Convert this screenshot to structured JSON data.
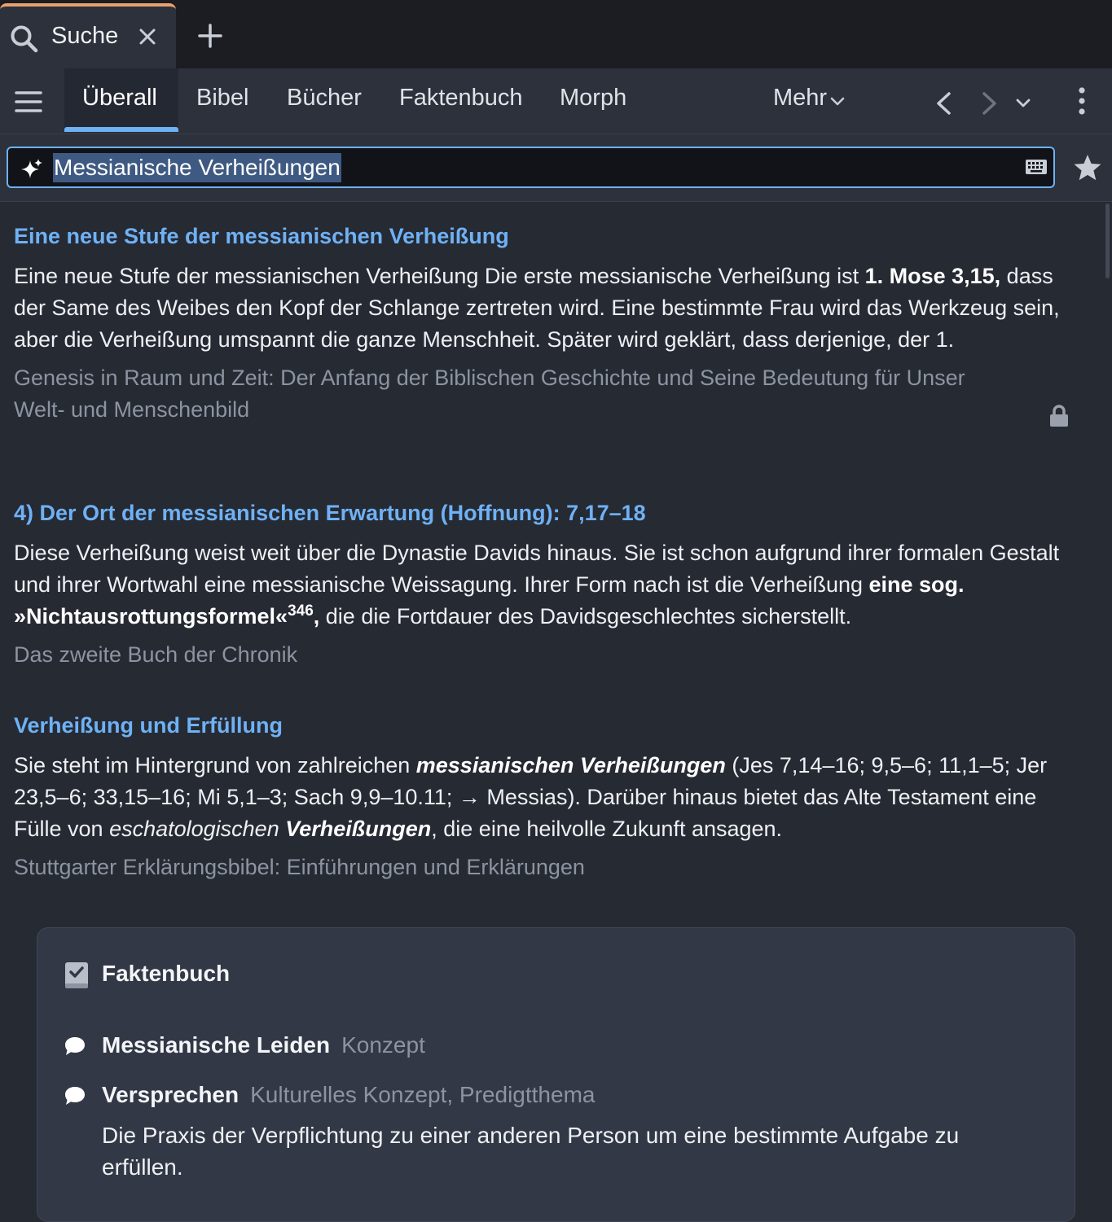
{
  "tab": {
    "label": "Suche"
  },
  "nav": {
    "tabs": [
      "Überall",
      "Bibel",
      "Bücher",
      "Faktenbuch",
      "Morph"
    ],
    "more_label": "Mehr"
  },
  "search": {
    "query": "Messianische Verheißungen"
  },
  "results": [
    {
      "title": "Eine neue Stufe der messianischen Verheißung",
      "body_parts": [
        "Eine neue Stufe der messianischen Verheißung Die erste messianische Verheißung ist ",
        "1. Mose 3,15,",
        " dass der Same des Weibes den Kopf der Schlange zertreten wird. Eine bestimmte Frau wird das Werkzeug sein, aber die Verheißung umspannt die ganze Menschheit. Später wird geklärt, dass derjenige, der 1."
      ],
      "source": "Genesis in Raum und Zeit: Der Anfang der Biblischen Geschichte und Seine Bedeutung für Unser Welt- und Menschenbild",
      "locked": true
    },
    {
      "title": "4) Der Ort der messianischen Erwartung (Hoffnung): 7,17–18",
      "body_parts": [
        "Diese Verheißung weist weit über die Dynastie Davids hinaus. Sie ist schon aufgrund ihrer formalen Gestalt und ihrer Wortwahl eine messianische Weissagung. Ihrer Form nach ist die Verheißung ",
        "eine sog. »Nichtausrottungsformel«",
        "346",
        ",",
        " die die Fortdauer des Davidsgeschlechtes sicherstellt."
      ],
      "source": "Das zweite Buch der Chronik"
    },
    {
      "title": "Verheißung und Erfüllung",
      "body_parts": [
        "Sie steht im Hintergrund von zahlreichen ",
        "messianischen Verheißungen",
        " (Jes 7,14–16; 9,5–6; 11,1–5; Jer 23,5–6; 33,15–16; Mi 5,1–3; Sach 9,9–10.11; → Messias). Darüber hinaus bietet das Alte Testament eine Fülle von ",
        "eschatologischen",
        " ",
        "Verheißungen",
        ", die eine heilvolle Zukunft ansagen."
      ],
      "source": "Stuttgarter Erklärungsbibel: Einführungen und Erklärungen"
    }
  ],
  "factbook": {
    "title": "Faktenbuch",
    "items": [
      {
        "name": "Messianische Leiden",
        "type": "Konzept"
      },
      {
        "name": "Versprechen",
        "type": "Kulturelles Konzept, Predigtthema",
        "description": "Die Praxis der Verpflichtung zu einer anderen Person um eine bestimmte Aufgabe zu erfüllen."
      }
    ]
  },
  "colors": {
    "accent": "#6fb1f5",
    "tab_accent": "#e9a16f",
    "background": "#262a33",
    "source_text": "#8d94a1"
  }
}
